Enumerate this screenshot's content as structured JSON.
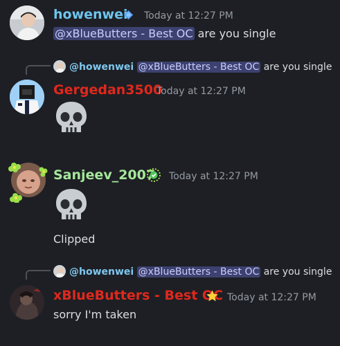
{
  "messages": [
    {
      "username": "howenwei",
      "username_color": "#6ec4ee",
      "badge_icon": "diamond-icon",
      "timestamp": "Today at 12:27 PM",
      "mention": "@xBlueButters - Best OC",
      "text": " are you single"
    },
    {
      "reply": {
        "name": "@howenwei",
        "mention": "@xBlueButters - Best OC",
        "text": " are you single"
      },
      "username": "Gergedan3500",
      "username_color": "#e0281d",
      "timestamp": "Today at 12:27 PM",
      "emoji": "skull-emoji"
    },
    {
      "username": "Sanjeev_2007",
      "username_color": "#a5e89a",
      "badge_icon": "nitro-gem-icon",
      "timestamp": "Today at 12:27 PM",
      "emoji": "skull-emoji",
      "text": "Clipped"
    },
    {
      "reply": {
        "name": "@howenwei",
        "mention": "@xBlueButters - Best OC",
        "text": " are you single"
      },
      "username": "xBlueButters - Best OC",
      "username_color": "#e0281d",
      "badge_icon": "star-icon",
      "timestamp": "Today at 12:27 PM",
      "text": "sorry I'm taken"
    }
  ]
}
